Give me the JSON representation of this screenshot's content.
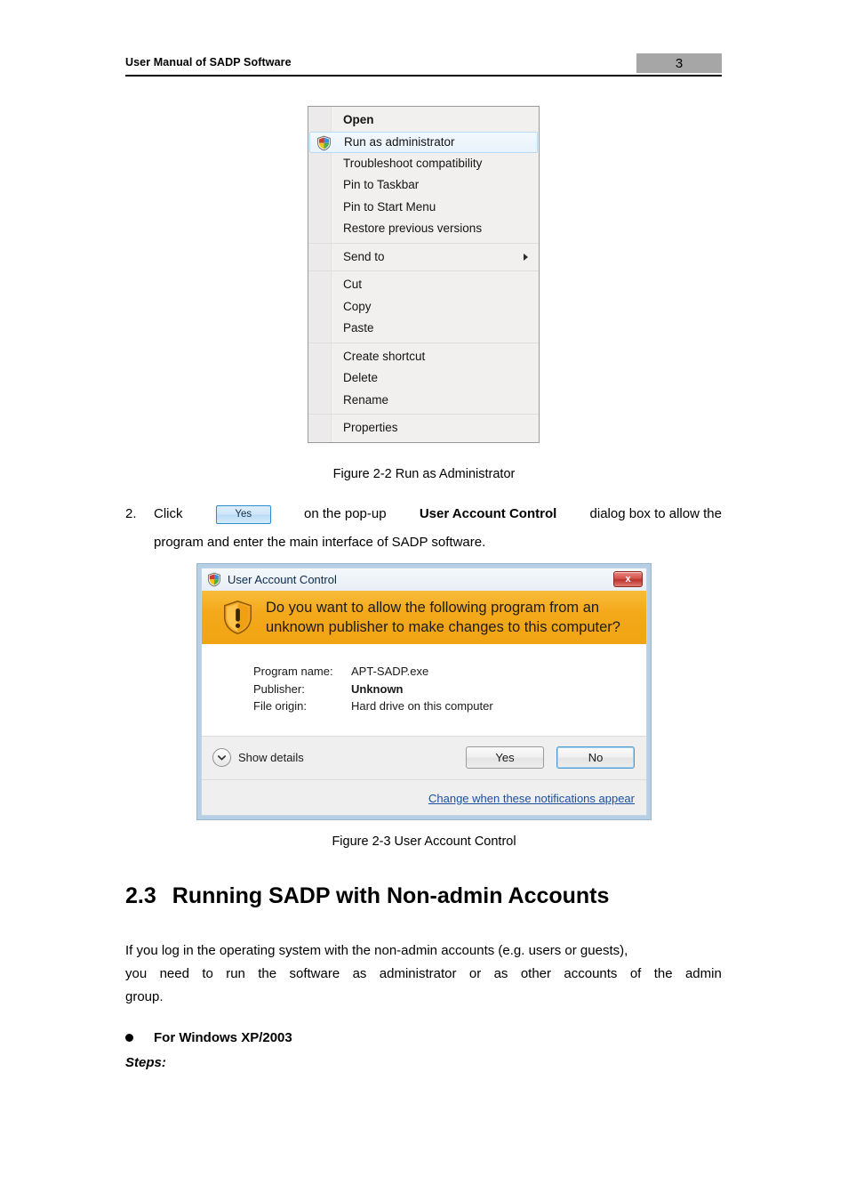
{
  "header": {
    "title": "User Manual of SADP Software",
    "page_number": "3"
  },
  "context_menu": {
    "name": "file-context-menu",
    "groups": [
      {
        "items": [
          {
            "label": "Open",
            "bold": true,
            "icon": null,
            "selected": false,
            "submenu": false
          },
          {
            "label": "Run as administrator",
            "bold": false,
            "icon": "shield-icon",
            "selected": true,
            "submenu": false
          },
          {
            "label": "Troubleshoot compatibility",
            "bold": false,
            "icon": null,
            "selected": false,
            "submenu": false
          },
          {
            "label": "Pin to Taskbar",
            "bold": false,
            "icon": null,
            "selected": false,
            "submenu": false
          },
          {
            "label": "Pin to Start Menu",
            "bold": false,
            "icon": null,
            "selected": false,
            "submenu": false
          },
          {
            "label": "Restore previous versions",
            "bold": false,
            "icon": null,
            "selected": false,
            "submenu": false
          }
        ]
      },
      {
        "items": [
          {
            "label": "Send to",
            "bold": false,
            "icon": null,
            "selected": false,
            "submenu": true
          }
        ]
      },
      {
        "items": [
          {
            "label": "Cut",
            "bold": false,
            "icon": null,
            "selected": false,
            "submenu": false
          },
          {
            "label": "Copy",
            "bold": false,
            "icon": null,
            "selected": false,
            "submenu": false
          },
          {
            "label": "Paste",
            "bold": false,
            "icon": null,
            "selected": false,
            "submenu": false
          }
        ]
      },
      {
        "items": [
          {
            "label": "Create shortcut",
            "bold": false,
            "icon": null,
            "selected": false,
            "submenu": false
          },
          {
            "label": "Delete",
            "bold": false,
            "icon": null,
            "selected": false,
            "submenu": false
          },
          {
            "label": "Rename",
            "bold": false,
            "icon": null,
            "selected": false,
            "submenu": false
          }
        ]
      },
      {
        "items": [
          {
            "label": "Properties",
            "bold": false,
            "icon": null,
            "selected": false,
            "submenu": false
          }
        ]
      }
    ]
  },
  "figure_2_2_caption": "Figure 2-2 Run as Administrator",
  "step2": {
    "number": "2.",
    "text_before_button": "Click",
    "button_label": "Yes",
    "segment_a": "on  the  pop-up",
    "bold_segment": "User  Account  Control",
    "segment_b": "dialog  box  to  allow  the",
    "line2": "program and enter the main interface of SADP software."
  },
  "uac_dialog": {
    "title": "User Account Control",
    "close_label": "x",
    "banner_text_line1": "Do you want to allow the following program from an",
    "banner_text_line2": "unknown publisher to make changes to this computer?",
    "details": [
      {
        "label": "Program name:",
        "value": "APT-SADP.exe",
        "bold": false
      },
      {
        "label": "Publisher:",
        "value": "Unknown",
        "bold": true
      },
      {
        "label": "File origin:",
        "value": "Hard drive on this computer",
        "bold": false
      }
    ],
    "show_details_label": "Show details",
    "yes_label": "Yes",
    "no_label": "No",
    "footer_link": "Change when these notifications appear"
  },
  "figure_2_3_caption": "Figure 2-3 User Account Control",
  "section": {
    "number": "2.3",
    "title": "Running SADP with Non-admin Accounts"
  },
  "paragraph": {
    "line1": "If you log in the operating system with the non-admin accounts (e.g. users or guests),",
    "line2_words": [
      "you",
      "need",
      "to",
      "run",
      "the",
      "software",
      "as",
      "administrator",
      "or",
      "as",
      "other",
      "accounts",
      "of",
      "the",
      "admin"
    ],
    "line3": "group."
  },
  "bullet": {
    "label": "For Windows XP/2003"
  },
  "steps_label": "Steps:",
  "colors": {
    "page_number_box": "#a6a6a6",
    "uac_banner": "#f4a91b",
    "uac_frame": "#b6cfe4",
    "link": "#1a4fa0",
    "close_button": "#bb332c",
    "menu_selection": "#e8f3fc"
  }
}
